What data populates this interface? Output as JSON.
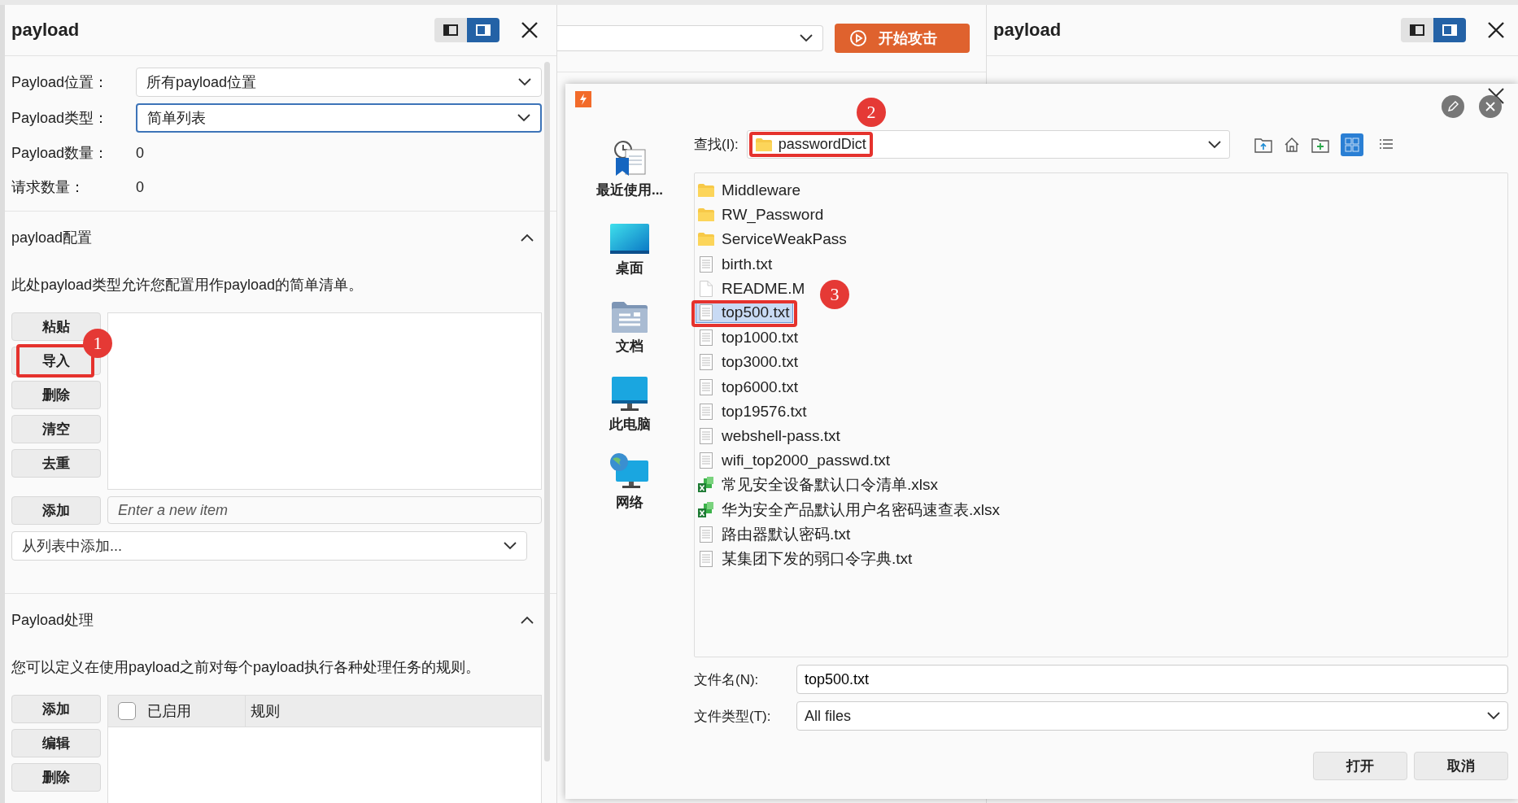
{
  "left_panel": {
    "title": "payload",
    "view_toggle": [
      {
        "selected": false
      },
      {
        "selected": true
      }
    ],
    "fields": [
      {
        "label": "Payload位置：",
        "value": "所有payload位置",
        "focused": false
      },
      {
        "label": "Payload类型：",
        "value": "简单列表",
        "focused": true
      }
    ],
    "stats": [
      {
        "label": "Payload数量：",
        "value": "0"
      },
      {
        "label": "请求数量：",
        "value": "0"
      }
    ],
    "payload_config": {
      "title": "payload配置",
      "expanded": true,
      "description": "此处payload类型允许您配置用作payload的简单清单。",
      "buttons": [
        "粘贴",
        "导入",
        "删除",
        "清空",
        "去重"
      ],
      "add_button": "添加",
      "new_item_placeholder": "Enter a new item",
      "add_from_list": "从列表中添加..."
    },
    "payload_processing": {
      "title": "Payload处理",
      "expanded": true,
      "description": "您可以定义在使用payload之前对每个payload执行各种处理任务的规则。",
      "buttons": [
        "添加",
        "编辑",
        "删除"
      ],
      "columns": [
        "已启用",
        "规则"
      ],
      "all_enabled": false
    }
  },
  "background_window": {
    "start_button": "开始攻击"
  },
  "right_panel": {
    "title": "payload",
    "view_toggle": [
      {
        "selected": false
      },
      {
        "selected": true
      }
    ]
  },
  "file_dialog": {
    "look_in_label": "查找(I):",
    "look_in": "passwordDict",
    "places": [
      {
        "label": "最近使用...",
        "kind": "recent"
      },
      {
        "label": "桌面",
        "kind": "desktop"
      },
      {
        "label": "文档",
        "kind": "documents"
      },
      {
        "label": "此电脑",
        "kind": "computer"
      },
      {
        "label": "网络",
        "kind": "network"
      }
    ],
    "view_mode": [
      {
        "selected": true
      },
      {
        "selected": false
      }
    ],
    "files": [
      {
        "name": "Middleware",
        "kind": "folder",
        "selected": false
      },
      {
        "name": "RW_Password",
        "kind": "folder",
        "selected": false
      },
      {
        "name": "ServiceWeakPass",
        "kind": "folder",
        "selected": false
      },
      {
        "name": "birth.txt",
        "kind": "text",
        "selected": false
      },
      {
        "name": "README.M",
        "kind": "doc",
        "selected": false
      },
      {
        "name": "top500.txt",
        "kind": "text",
        "selected": true
      },
      {
        "name": "top1000.txt",
        "kind": "text",
        "selected": false
      },
      {
        "name": "top3000.txt",
        "kind": "text",
        "selected": false
      },
      {
        "name": "top6000.txt",
        "kind": "text",
        "selected": false
      },
      {
        "name": "top19576.txt",
        "kind": "text",
        "selected": false
      },
      {
        "name": "webshell-pass.txt",
        "kind": "text",
        "selected": false
      },
      {
        "name": "wifi_top2000_passwd.txt",
        "kind": "text",
        "selected": false
      },
      {
        "name": "常见安全设备默认口令清单.xlsx",
        "kind": "excel",
        "selected": false
      },
      {
        "name": "华为安全产品默认用户名密码速查表.xlsx",
        "kind": "excel",
        "selected": false
      },
      {
        "name": "路由器默认密码.txt",
        "kind": "text",
        "selected": false
      },
      {
        "name": "某集团下发的弱口令字典.txt",
        "kind": "text",
        "selected": false
      }
    ],
    "file_name_label": "文件名(N):",
    "file_name": "top500.txt",
    "file_type_label": "文件类型(T):",
    "file_type": "All files",
    "buttons": [
      "打开",
      "取消"
    ]
  },
  "callouts": [
    {
      "number": "1"
    },
    {
      "number": "2"
    },
    {
      "number": "3"
    }
  ]
}
